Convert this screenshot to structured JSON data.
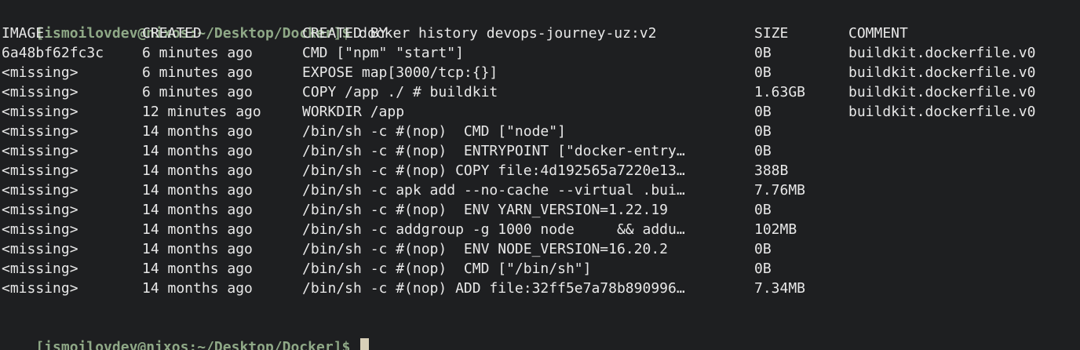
{
  "terminal": {
    "prompt": "[ismoilovdev@nixos:~/Desktop/Docker]$",
    "command": "docker history devops-journey-uz:v2",
    "headers": {
      "image": "IMAGE",
      "created": "CREATED",
      "created_by": "CREATED BY",
      "size": "SIZE",
      "comment": "COMMENT"
    },
    "rows": [
      {
        "image": "6a48bf62fc3c",
        "created": "6 minutes ago",
        "created_by": "CMD [\"npm\" \"start\"]",
        "size": "0B",
        "comment": "buildkit.dockerfile.v0"
      },
      {
        "image": "<missing>",
        "created": "6 minutes ago",
        "created_by": "EXPOSE map[3000/tcp:{}]",
        "size": "0B",
        "comment": "buildkit.dockerfile.v0"
      },
      {
        "image": "<missing>",
        "created": "6 minutes ago",
        "created_by": "COPY /app ./ # buildkit",
        "size": "1.63GB",
        "comment": "buildkit.dockerfile.v0"
      },
      {
        "image": "<missing>",
        "created": "12 minutes ago",
        "created_by": "WORKDIR /app",
        "size": "0B",
        "comment": "buildkit.dockerfile.v0"
      },
      {
        "image": "<missing>",
        "created": "14 months ago",
        "created_by": "/bin/sh -c #(nop)  CMD [\"node\"]",
        "size": "0B",
        "comment": ""
      },
      {
        "image": "<missing>",
        "created": "14 months ago",
        "created_by": "/bin/sh -c #(nop)  ENTRYPOINT [\"docker-entry…",
        "size": "0B",
        "comment": ""
      },
      {
        "image": "<missing>",
        "created": "14 months ago",
        "created_by": "/bin/sh -c #(nop) COPY file:4d192565a7220e13…",
        "size": "388B",
        "comment": ""
      },
      {
        "image": "<missing>",
        "created": "14 months ago",
        "created_by": "/bin/sh -c apk add --no-cache --virtual .bui…",
        "size": "7.76MB",
        "comment": ""
      },
      {
        "image": "<missing>",
        "created": "14 months ago",
        "created_by": "/bin/sh -c #(nop)  ENV YARN_VERSION=1.22.19",
        "size": "0B",
        "comment": ""
      },
      {
        "image": "<missing>",
        "created": "14 months ago",
        "created_by": "/bin/sh -c addgroup -g 1000 node     && addu…",
        "size": "102MB",
        "comment": ""
      },
      {
        "image": "<missing>",
        "created": "14 months ago",
        "created_by": "/bin/sh -c #(nop)  ENV NODE_VERSION=16.20.2",
        "size": "0B",
        "comment": ""
      },
      {
        "image": "<missing>",
        "created": "14 months ago",
        "created_by": "/bin/sh -c #(nop)  CMD [\"/bin/sh\"]",
        "size": "0B",
        "comment": ""
      },
      {
        "image": "<missing>",
        "created": "14 months ago",
        "created_by": "/bin/sh -c #(nop) ADD file:32ff5e7a78b890996…",
        "size": "7.34MB",
        "comment": ""
      }
    ],
    "final_prompt": "[ismoilovdev@nixos:~/Desktop/Docker]$"
  }
}
